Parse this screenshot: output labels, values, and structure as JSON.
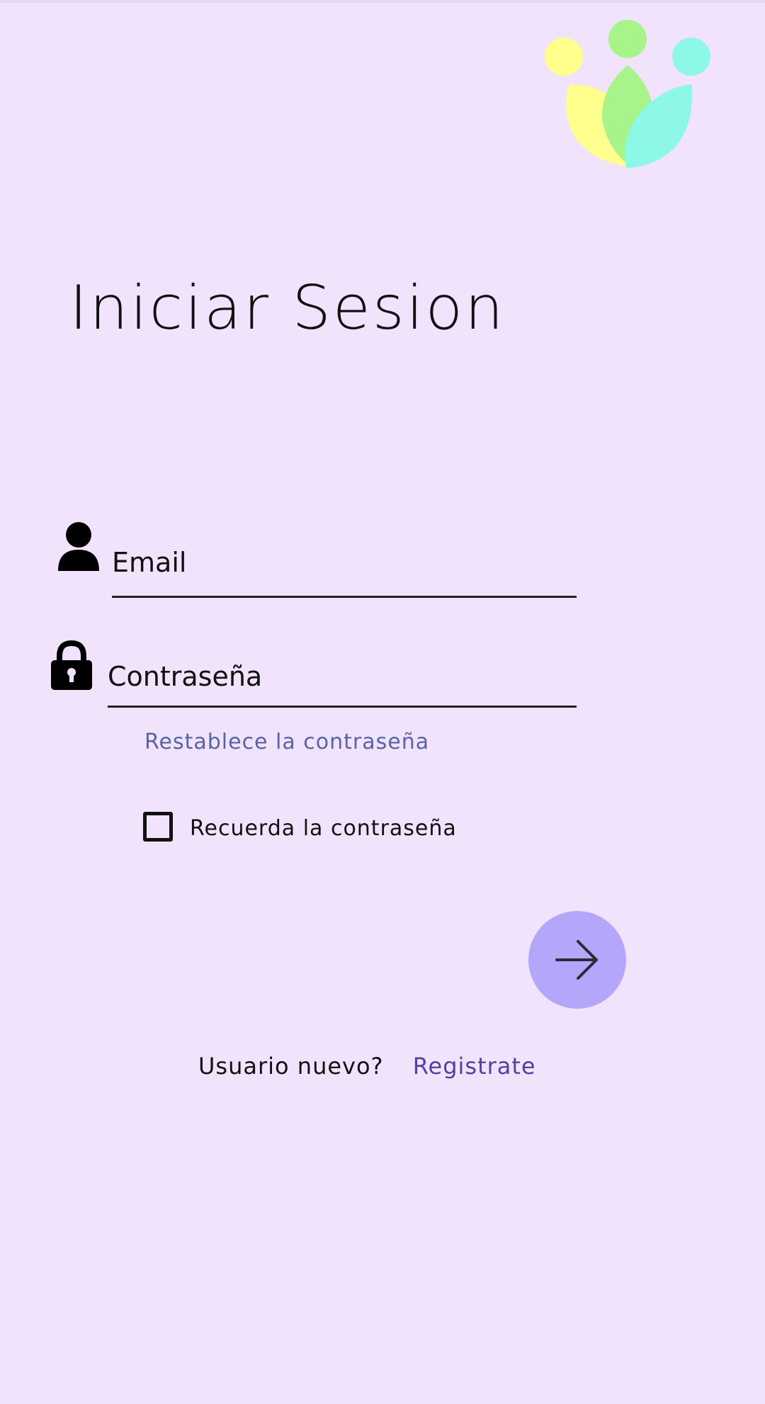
{
  "colors": {
    "background": "#f0e3fb",
    "accent_button": "#b4a6fb",
    "link": "#5964a6",
    "register_link": "#5a3da0",
    "logo_yellow": "#ffff8d",
    "logo_green": "#a8f48a",
    "logo_cyan": "#8ef8e6"
  },
  "header": {
    "title": "Iniciar Sesion",
    "logo_icon": "people-leaves-logo"
  },
  "form": {
    "email": {
      "icon": "person-icon",
      "placeholder": "Email",
      "value": ""
    },
    "password": {
      "icon": "lock-icon",
      "placeholder": "Contraseña",
      "value": ""
    },
    "reset_link": "Restablece la contraseña",
    "remember": {
      "label": "Recuerda la contraseña",
      "checked": false
    },
    "submit_icon": "arrow-right-icon"
  },
  "footer": {
    "prompt": "Usuario nuevo?",
    "register_link": "Registrate"
  }
}
